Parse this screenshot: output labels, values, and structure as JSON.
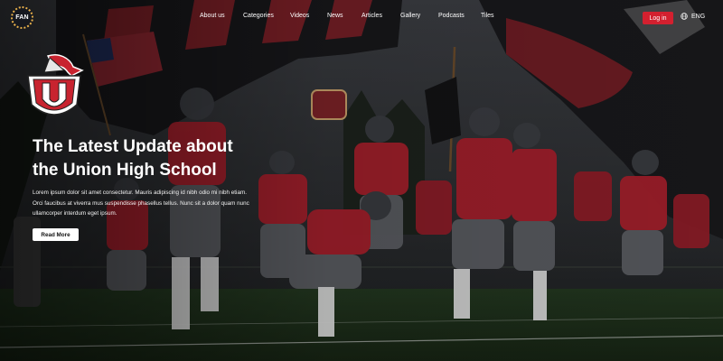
{
  "header": {
    "logo_text": "FAN",
    "nav": [
      {
        "label": "About us"
      },
      {
        "label": "Categories"
      },
      {
        "label": "Videos"
      },
      {
        "label": "News"
      },
      {
        "label": "Articles"
      },
      {
        "label": "Gallery"
      },
      {
        "label": "Podcasts"
      },
      {
        "label": "Tiles"
      }
    ],
    "login_label": "Log in",
    "language": "ENG"
  },
  "hero": {
    "title_line1": "The Latest Update about",
    "title_line2": "the Union High School",
    "body": "Lorem ipsum dolor sit amet consectetur. Mauris adipiscing id nibh odio mi nibh etiam. Orci faucibus at viverra mus suspendisse phasellus tellus. Nunc sit a dolor quam nunc ullamcorper interdum eget ipsum.",
    "cta_label": "Read More"
  },
  "crest": {
    "letter": "U"
  },
  "colors": {
    "accent": "#d3202f",
    "logo_ring": "#e8b04a",
    "field": "#1f3a1c",
    "jersey": "#c8232f"
  },
  "icons": [
    "fan-logo",
    "globe-icon",
    "crest-logo"
  ]
}
